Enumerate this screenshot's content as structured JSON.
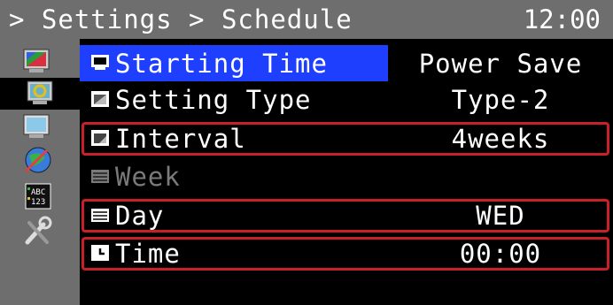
{
  "header": {
    "breadcrumb": "> Settings > Schedule",
    "clock": "12:00"
  },
  "sidebar": {
    "icons": [
      "color-palette-icon",
      "monitor-gear-icon",
      "monitor-icon",
      "globe-arrow-icon",
      "abc-123-icon",
      "wrench-icon"
    ]
  },
  "menu": {
    "rows": [
      {
        "label": "Starting Time",
        "value": "Power Save",
        "icon": "monitor-screen-icon"
      },
      {
        "label": "Setting Type",
        "value": "Type-2",
        "icon": "window-icon"
      },
      {
        "label": "Interval",
        "value": "4weeks",
        "icon": "window-corner-icon"
      },
      {
        "label": "Week",
        "value": "",
        "icon": "keyboard-icon"
      },
      {
        "label": "Day",
        "value": "WED",
        "icon": "keyboard-icon"
      },
      {
        "label": "Time",
        "value": "00:00",
        "icon": "clock-icon"
      }
    ]
  },
  "colors": {
    "highlight": "#1f3fff",
    "frame": "#c8202a",
    "bar": "#6e6e6e"
  }
}
